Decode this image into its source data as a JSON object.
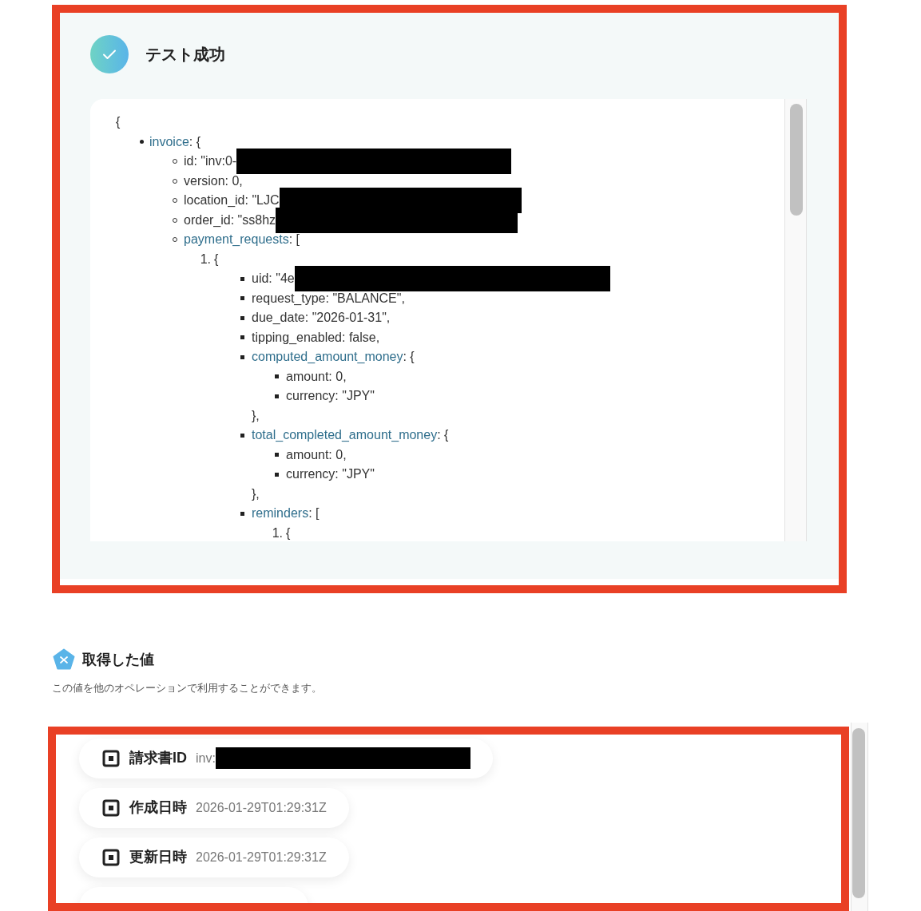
{
  "test_result": {
    "title": "テスト成功",
    "code": {
      "open": "{",
      "list": {
        "kind": "disc",
        "items": [
          {
            "key": "invoice",
            "text": ": {",
            "list": {
              "kind": "circle",
              "items": [
                {
                  "text": "id: \"inv:0-",
                  "redacted": true
                },
                {
                  "text": "version: 0,"
                },
                {
                  "text": "location_id: \"LJC",
                  "redacted": true
                },
                {
                  "text": "order_id: \"ss8hz",
                  "redacted": true
                },
                {
                  "key": "payment_requests",
                  "text": ": [",
                  "list": {
                    "kind": "ordered",
                    "items": [
                      {
                        "marker": "1.",
                        "text": "{",
                        "list": {
                          "kind": "square",
                          "items": [
                            {
                              "text": "uid: \"4e",
                              "redacted": true
                            },
                            {
                              "text": "request_type: \"BALANCE\","
                            },
                            {
                              "text": "due_date: \"2026-01-31\","
                            },
                            {
                              "text": "tipping_enabled: false,"
                            },
                            {
                              "key": "computed_amount_money",
                              "text": ": {",
                              "close": "},",
                              "list": {
                                "kind": "square",
                                "items": [
                                  {
                                    "text": "amount: 0,"
                                  },
                                  {
                                    "text": "currency: \"JPY\""
                                  }
                                ]
                              }
                            },
                            {
                              "key": "total_completed_amount_money",
                              "text": ": {",
                              "close": "},",
                              "list": {
                                "kind": "square",
                                "items": [
                                  {
                                    "text": "amount: 0,"
                                  },
                                  {
                                    "text": "currency: \"JPY\""
                                  }
                                ]
                              }
                            },
                            {
                              "key": "reminders",
                              "text": ": [",
                              "list": {
                                "kind": "ordered",
                                "items": [
                                  {
                                    "marker": "1.",
                                    "text": "{"
                                  }
                                ]
                              }
                            }
                          ]
                        }
                      }
                    ]
                  }
                }
              ]
            }
          }
        ]
      }
    }
  },
  "values": {
    "title": "取得した値",
    "description": "この値を他のオペレーションで利用することができます。",
    "items": [
      {
        "label": "請求書ID",
        "value": "inv:",
        "redacted": true
      },
      {
        "label": "作成日時",
        "value": "2026-01-29T01:29:31Z"
      },
      {
        "label": "更新日時",
        "value": "2026-01-29T01:29:31Z"
      }
    ]
  }
}
